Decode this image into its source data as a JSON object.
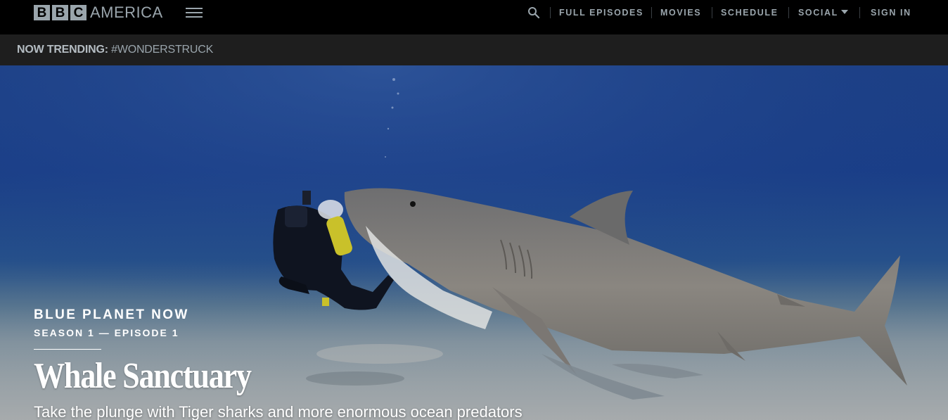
{
  "header": {
    "logo_letters": [
      "B",
      "B",
      "C"
    ],
    "logo_word": "AMERICA",
    "nav": {
      "full_episodes": "FULL EPISODES",
      "movies": "MOVIES",
      "schedule": "SCHEDULE",
      "social": "SOCIAL",
      "sign_in": "SIGN IN"
    }
  },
  "trending": {
    "label": "NOW TRENDING:",
    "tag": "#WONDERSTRUCK"
  },
  "hero": {
    "show_title": "BLUE PLANET NOW",
    "episode_label": "SEASON 1 — EPISODE 1",
    "episode_title": "Whale Sanctuary",
    "description": "Take the plunge with Tiger sharks and more enormous ocean predators"
  },
  "colors": {
    "header_bg": "#000000",
    "nav_text": "#9aa5ac",
    "trending_bg": "#1e1e1e"
  }
}
